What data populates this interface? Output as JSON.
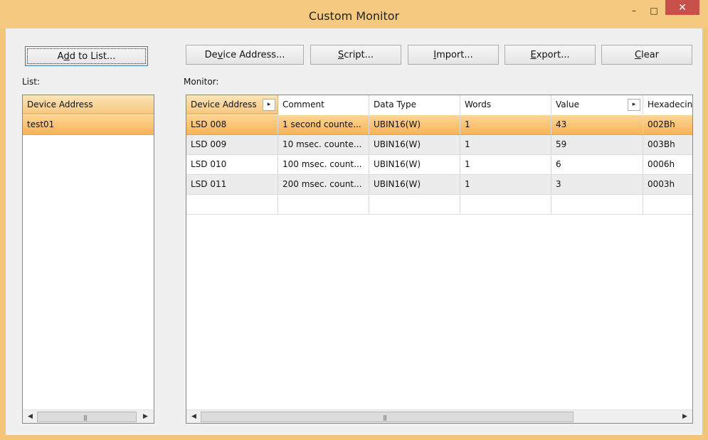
{
  "window": {
    "title": "Custom Monitor",
    "minimize_glyph": "–",
    "maximize_glyph": "□",
    "close_glyph": "✕"
  },
  "toolbar": {
    "add_to_list": {
      "pre": "A",
      "ul": "d",
      "post": "d to List..."
    },
    "device_address": {
      "pre": "De",
      "ul": "v",
      "post": "ice Address..."
    },
    "script": {
      "pre": "",
      "ul": "S",
      "post": "cript..."
    },
    "import": {
      "pre": "",
      "ul": "I",
      "post": "mport..."
    },
    "export": {
      "pre": "",
      "ul": "E",
      "post": "xport..."
    },
    "clear": {
      "pre": "",
      "ul": "C",
      "post": "lear"
    }
  },
  "list": {
    "label": "List:",
    "header": "Device Address",
    "items": [
      "test01"
    ]
  },
  "monitor": {
    "label": "Monitor:",
    "columns": [
      "Device Address",
      "Comment",
      "Data Type",
      "Words",
      "Value",
      "Hexadecimal"
    ],
    "column_header_visible": [
      "Device Address",
      "Comment",
      "Data Type",
      "Words",
      "Value",
      "Hexadecin"
    ],
    "rows": [
      {
        "device": "LSD 008",
        "comment": "1 second counte...",
        "type": "UBIN16(W)",
        "words": "1",
        "value": "43",
        "hex": "002Bh"
      },
      {
        "device": "LSD 009",
        "comment": "10 msec. counte...",
        "type": "UBIN16(W)",
        "words": "1",
        "value": "59",
        "hex": "003Bh"
      },
      {
        "device": "LSD 010",
        "comment": "100 msec. count...",
        "type": "UBIN16(W)",
        "words": "1",
        "value": "6",
        "hex": "0006h"
      },
      {
        "device": "LSD 011",
        "comment": "200 msec. count...",
        "type": "UBIN16(W)",
        "words": "1",
        "value": "3",
        "hex": "0003h"
      }
    ],
    "selected_row": 0
  },
  "icons": {
    "expand_arrow": "▸",
    "scroll_left": "◀",
    "scroll_right": "▶",
    "grip": "|||"
  },
  "colors": {
    "title_bar": "#f6c981",
    "selection": "#f9b456",
    "close_button": "#c7504b"
  }
}
